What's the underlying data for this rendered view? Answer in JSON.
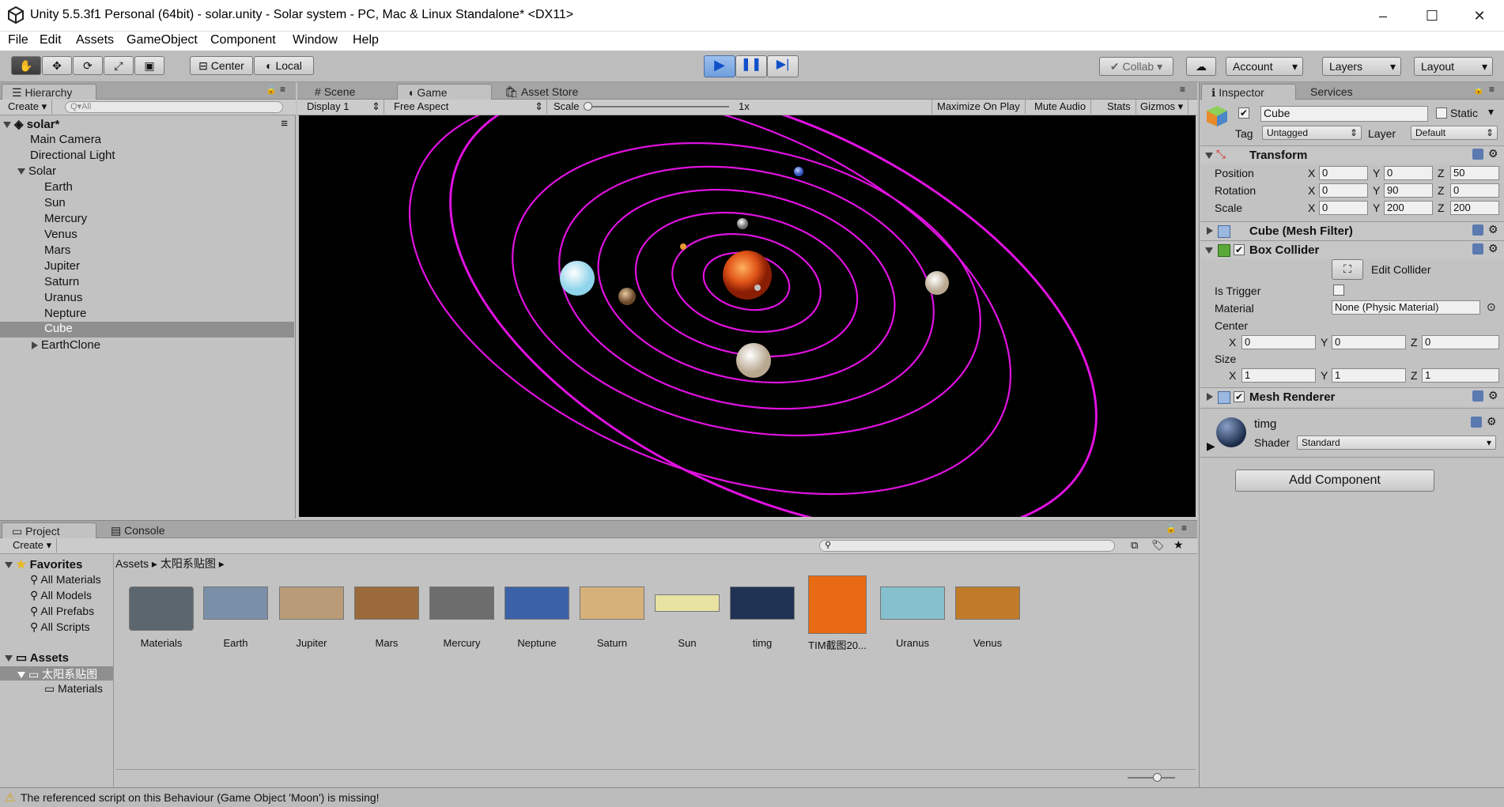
{
  "window": {
    "title": "Unity 5.5.3f1 Personal (64bit) - solar.unity - Solar system - PC, Mac & Linux Standalone* <DX11>"
  },
  "menu": [
    "File",
    "Edit",
    "Assets",
    "GameObject",
    "Component",
    "Window",
    "Help"
  ],
  "toolbar": {
    "center_label": "Center",
    "local_label": "Local",
    "collab_label": "Collab",
    "account_label": "Account",
    "layers_label": "Layers",
    "layout_label": "Layout"
  },
  "hierarchy": {
    "tab_label": "Hierarchy",
    "create_label": "Create",
    "search_placeholder": "Q▾All",
    "scene_name": "solar*",
    "items": [
      "Main Camera",
      "Directional Light",
      "Solar",
      "Earth",
      "Sun",
      "Mercury",
      "Venus",
      "Mars",
      "Jupiter",
      "Saturn",
      "Uranus",
      "Nepture",
      "Cube",
      "EarthClone"
    ]
  },
  "viewtabs": {
    "scene": "Scene",
    "game": "Game",
    "asset_store": "Asset Store"
  },
  "gamebar": {
    "display": "Display 1",
    "aspect": "Free Aspect",
    "scale_label": "Scale",
    "scale_value": "1x",
    "maximize": "Maximize On Play",
    "mute": "Mute Audio",
    "stats": "Stats",
    "gizmos": "Gizmos"
  },
  "inspector": {
    "tab_label": "Inspector",
    "services_label": "Services",
    "object_name": "Cube",
    "static_label": "Static",
    "tag_label": "Tag",
    "tag_value": "Untagged",
    "layer_label": "Layer",
    "layer_value": "Default",
    "transform": {
      "title": "Transform",
      "position_label": "Position",
      "rotation_label": "Rotation",
      "scale_label": "Scale",
      "position": [
        "0",
        "0",
        "50"
      ],
      "rotation": [
        "0",
        "90",
        "0"
      ],
      "scale": [
        "0",
        "200",
        "200"
      ]
    },
    "axis": [
      "X",
      "Y",
      "Z"
    ],
    "mesh_filter_title": "Cube (Mesh Filter)",
    "box_collider": {
      "title": "Box Collider",
      "edit_collider": "Edit Collider",
      "is_trigger": "Is Trigger",
      "material_label": "Material",
      "material_value": "None (Physic Material)",
      "center_label": "Center",
      "center": [
        "0",
        "0",
        "0"
      ],
      "size_label": "Size",
      "size": [
        "1",
        "1",
        "1"
      ]
    },
    "mesh_renderer_title": "Mesh Renderer",
    "material": {
      "name": "timg",
      "shader_label": "Shader",
      "shader_value": "Standard"
    },
    "add_component": "Add Component"
  },
  "project": {
    "tab_label": "Project",
    "console_label": "Console",
    "create_label": "Create",
    "favorites_label": "Favorites",
    "favorites": [
      "All Materials",
      "All Models",
      "All Prefabs",
      "All Scripts"
    ],
    "assets_label": "Assets",
    "folder_selected": "太阳系贴图",
    "subfolder": "Materials",
    "breadcrumb": [
      "Assets",
      "太阳系贴图"
    ],
    "assets": [
      {
        "name": "Materials",
        "color": "#5b666e"
      },
      {
        "name": "Earth",
        "color": "#7a8fa8"
      },
      {
        "name": "Jupiter",
        "color": "#b99b78"
      },
      {
        "name": "Mars",
        "color": "#9a6a3a"
      },
      {
        "name": "Mercury",
        "color": "#6d6d6d"
      },
      {
        "name": "Neptune",
        "color": "#3b62a8"
      },
      {
        "name": "Saturn",
        "color": "#d6b27a"
      },
      {
        "name": "Sun",
        "color": "#e8e3a2"
      },
      {
        "name": "timg",
        "color": "#203252"
      },
      {
        "name": "TIM截图20...",
        "color": "#e86a12"
      },
      {
        "name": "Uranus",
        "color": "#86c0cc"
      },
      {
        "name": "Venus",
        "color": "#c07a28"
      }
    ]
  },
  "status": {
    "message": "The referenced script on this Behaviour (Game Object 'Moon') is missing!"
  }
}
